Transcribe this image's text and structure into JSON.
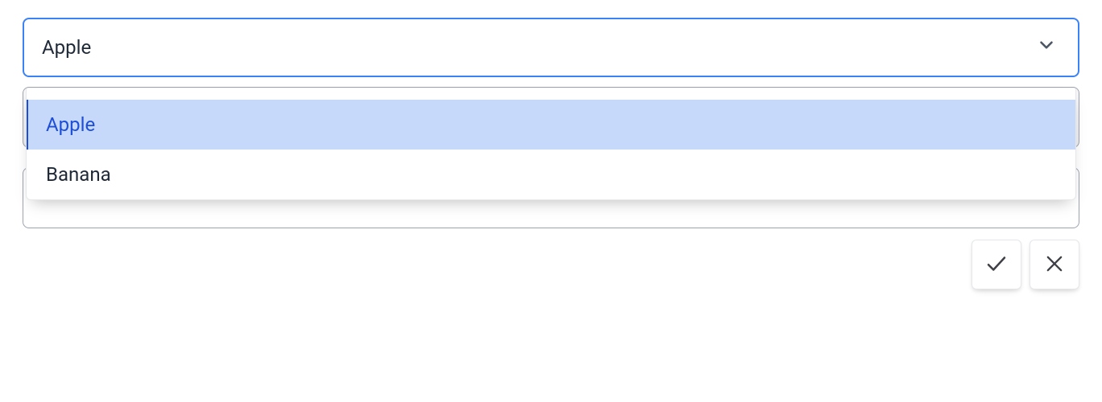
{
  "select": {
    "value": "Apple",
    "options": [
      {
        "label": "Apple",
        "selected": true
      },
      {
        "label": "Banana",
        "selected": false
      }
    ]
  },
  "text_input": {
    "value": ""
  }
}
